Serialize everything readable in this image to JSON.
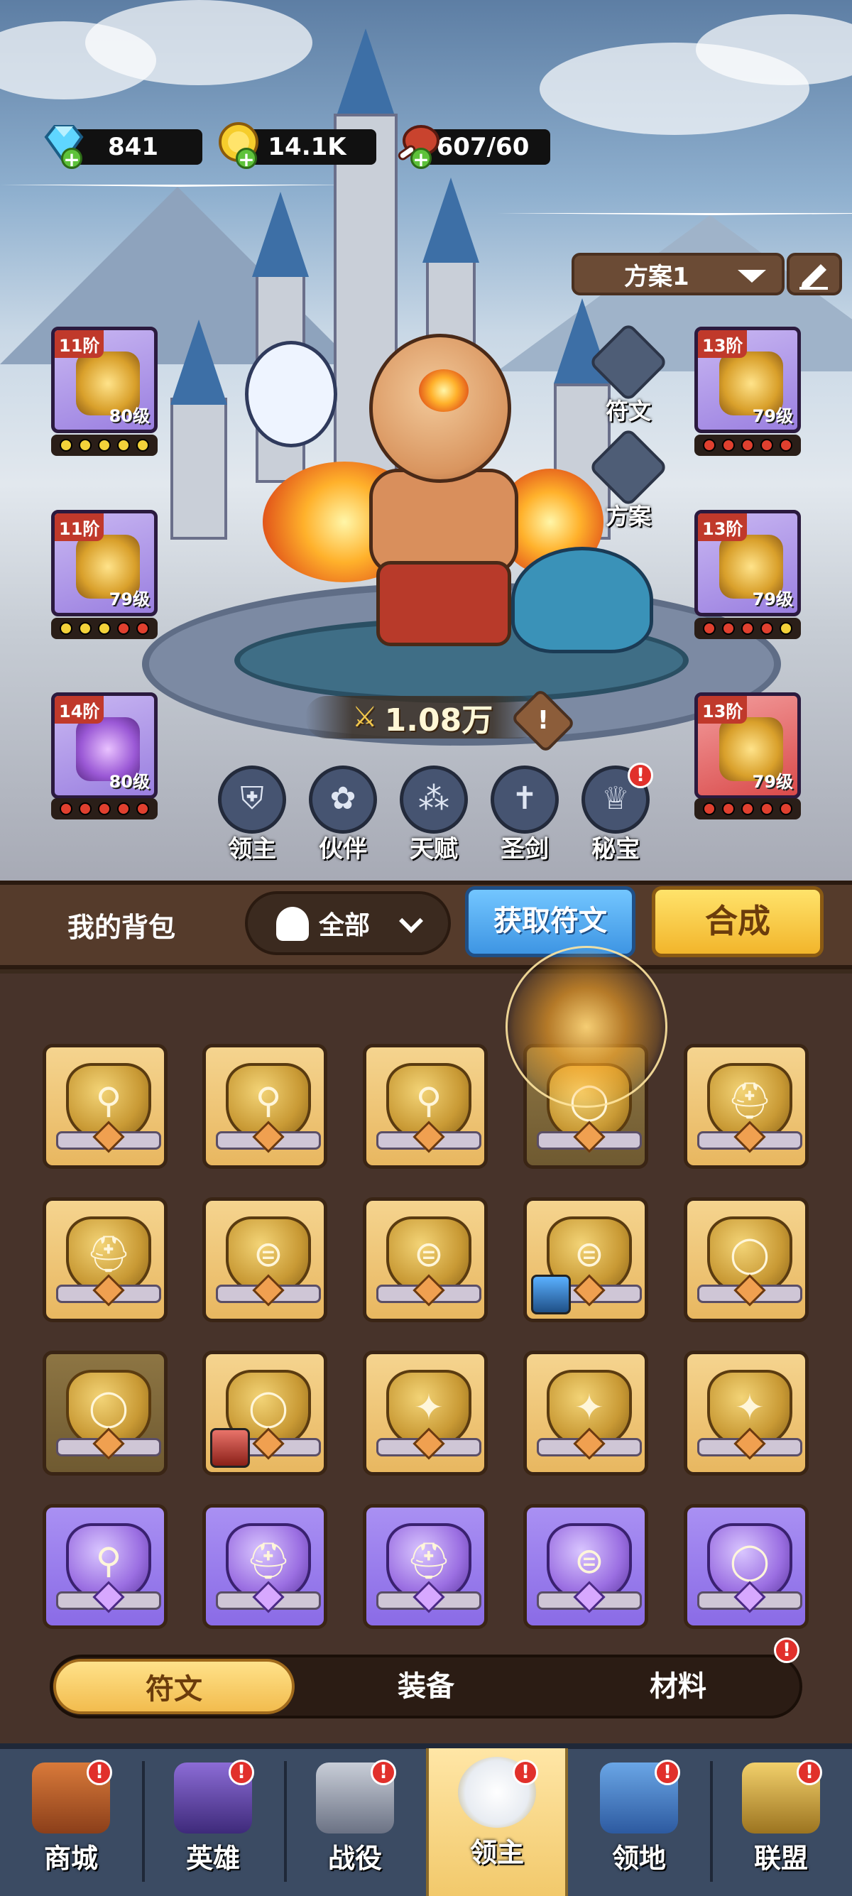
{
  "resources": {
    "gems": "841",
    "gold": "14.1K",
    "stamina": "607/60"
  },
  "plan_selector": {
    "label": "方案1"
  },
  "equipment": [
    {
      "tier": "11阶",
      "level": "80级",
      "dots": [
        "y",
        "y",
        "y",
        "y",
        "y"
      ]
    },
    {
      "tier": "11阶",
      "level": "79级",
      "dots": [
        "y",
        "y",
        "y",
        "r",
        "r"
      ]
    },
    {
      "tier": "14阶",
      "level": "80级",
      "dots": [
        "r",
        "r",
        "r",
        "r",
        "r"
      ]
    },
    {
      "tier": "13阶",
      "level": "79级",
      "dots": [
        "r",
        "r",
        "r",
        "r",
        "r"
      ]
    },
    {
      "tier": "13阶",
      "level": "79级",
      "dots": [
        "r",
        "r",
        "r",
        "r",
        "y"
      ]
    },
    {
      "tier": "13阶",
      "level": "79级",
      "dots": [
        "r",
        "r",
        "r",
        "r",
        "r"
      ]
    }
  ],
  "side_badges": {
    "rune": "符文",
    "plan": "方案"
  },
  "power": {
    "value": "1.08万",
    "info": "!"
  },
  "features": [
    {
      "label": "领主",
      "icon": "lord-shield-icon"
    },
    {
      "label": "伙伴",
      "icon": "paw-icon"
    },
    {
      "label": "天赋",
      "icon": "talent-nodes-icon"
    },
    {
      "label": "圣剑",
      "icon": "holy-sword-icon"
    },
    {
      "label": "秘宝",
      "icon": "trophy-icon",
      "alert": "!"
    }
  ],
  "backpack": {
    "title": "我的背包",
    "filter": "全部",
    "get_runes": "获取符文",
    "synthesize": "合成"
  },
  "runes": [
    {
      "color": "gold",
      "symbol": "boot"
    },
    {
      "color": "gold",
      "symbol": "boot"
    },
    {
      "color": "gold",
      "symbol": "boot"
    },
    {
      "color": "gold-dim",
      "symbol": "ring",
      "glow": true
    },
    {
      "color": "gold",
      "symbol": "helmet"
    },
    {
      "color": "gold",
      "symbol": "helmet"
    },
    {
      "color": "gold",
      "symbol": "belt"
    },
    {
      "color": "gold",
      "symbol": "belt"
    },
    {
      "color": "gold",
      "symbol": "belt",
      "avatar": "blue-hero"
    },
    {
      "color": "gold",
      "symbol": "ring"
    },
    {
      "color": "gold-dim",
      "symbol": "ring"
    },
    {
      "color": "gold",
      "symbol": "ring",
      "avatar": "red-hero"
    },
    {
      "color": "gold",
      "symbol": "amulet"
    },
    {
      "color": "gold",
      "symbol": "amulet"
    },
    {
      "color": "gold",
      "symbol": "amulet"
    },
    {
      "color": "purple",
      "symbol": "boot"
    },
    {
      "color": "purple",
      "symbol": "helmet"
    },
    {
      "color": "purple",
      "symbol": "helmet"
    },
    {
      "color": "purple",
      "symbol": "belt"
    },
    {
      "color": "purple",
      "symbol": "ring"
    }
  ],
  "tabs": [
    {
      "label": "符文",
      "active": true
    },
    {
      "label": "装备"
    },
    {
      "label": "材料",
      "alert": "!"
    }
  ],
  "nav": [
    {
      "label": "商城",
      "icon": "shop-icon",
      "alert": "!"
    },
    {
      "label": "英雄",
      "icon": "hero-cards-icon",
      "alert": "!"
    },
    {
      "label": "战役",
      "icon": "crossed-swords-icon",
      "alert": "!"
    },
    {
      "label": "领主",
      "icon": "lord-crown-icon",
      "alert": "!",
      "active": true
    },
    {
      "label": "领地",
      "icon": "castle-icon",
      "alert": "!"
    },
    {
      "label": "联盟",
      "icon": "knight-helmet-icon",
      "alert": "!"
    }
  ]
}
